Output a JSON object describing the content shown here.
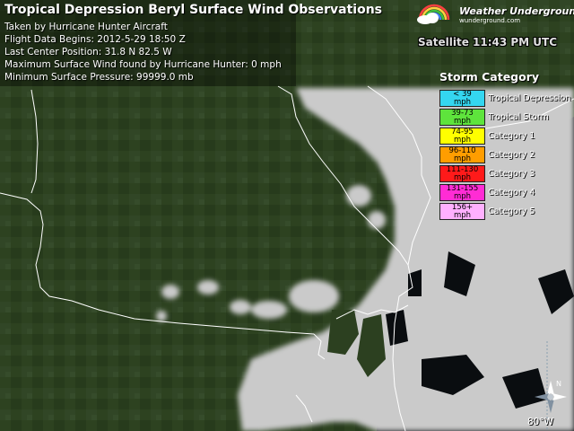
{
  "header": {
    "title": "Tropical Depression Beryl Surface Wind Observations",
    "lines": [
      "Taken by Hurricane Hunter Aircraft",
      "Flight Data Begins: 2012-5-29 18:50 Z",
      "Last Center Position: 31.8 N 82.5 W",
      "Maximum Surface Wind found by Hurricane Hunter: 0 mph",
      "Minimum Surface Pressure: 99999.0 mb"
    ]
  },
  "logo": {
    "name": "Weather Underground",
    "reg": "®",
    "url": "wunderground.com"
  },
  "satellite": {
    "label": "Satellite 11:43 PM UTC"
  },
  "legend": {
    "title": "Storm Category",
    "items": [
      {
        "range": "< 39",
        "unit": "mph",
        "label": "Tropical Depression",
        "color": "#34d6f0"
      },
      {
        "range": "39-73",
        "unit": "mph",
        "label": "Tropical Storm",
        "color": "#5ee43c"
      },
      {
        "range": "74-95",
        "unit": "mph",
        "label": "Category 1",
        "color": "#ffff00"
      },
      {
        "range": "96-110",
        "unit": "mph",
        "label": "Category 2",
        "color": "#ff9d00"
      },
      {
        "range": "111-130",
        "unit": "mph",
        "label": "Category 3",
        "color": "#ff1a1a"
      },
      {
        "range": "131-155",
        "unit": "mph",
        "label": "Category 4",
        "color": "#ff2cd4"
      },
      {
        "range": "156+",
        "unit": "mph",
        "label": "Category 5",
        "color": "#ffb0ff"
      }
    ]
  },
  "map": {
    "longitude_label": "80°W",
    "land_color": "#2f4420",
    "land_dark": "#1c2a12",
    "cloud_color": "#c8c8c8",
    "water_color": "#05070a"
  },
  "compass": {
    "north_label": "N"
  }
}
